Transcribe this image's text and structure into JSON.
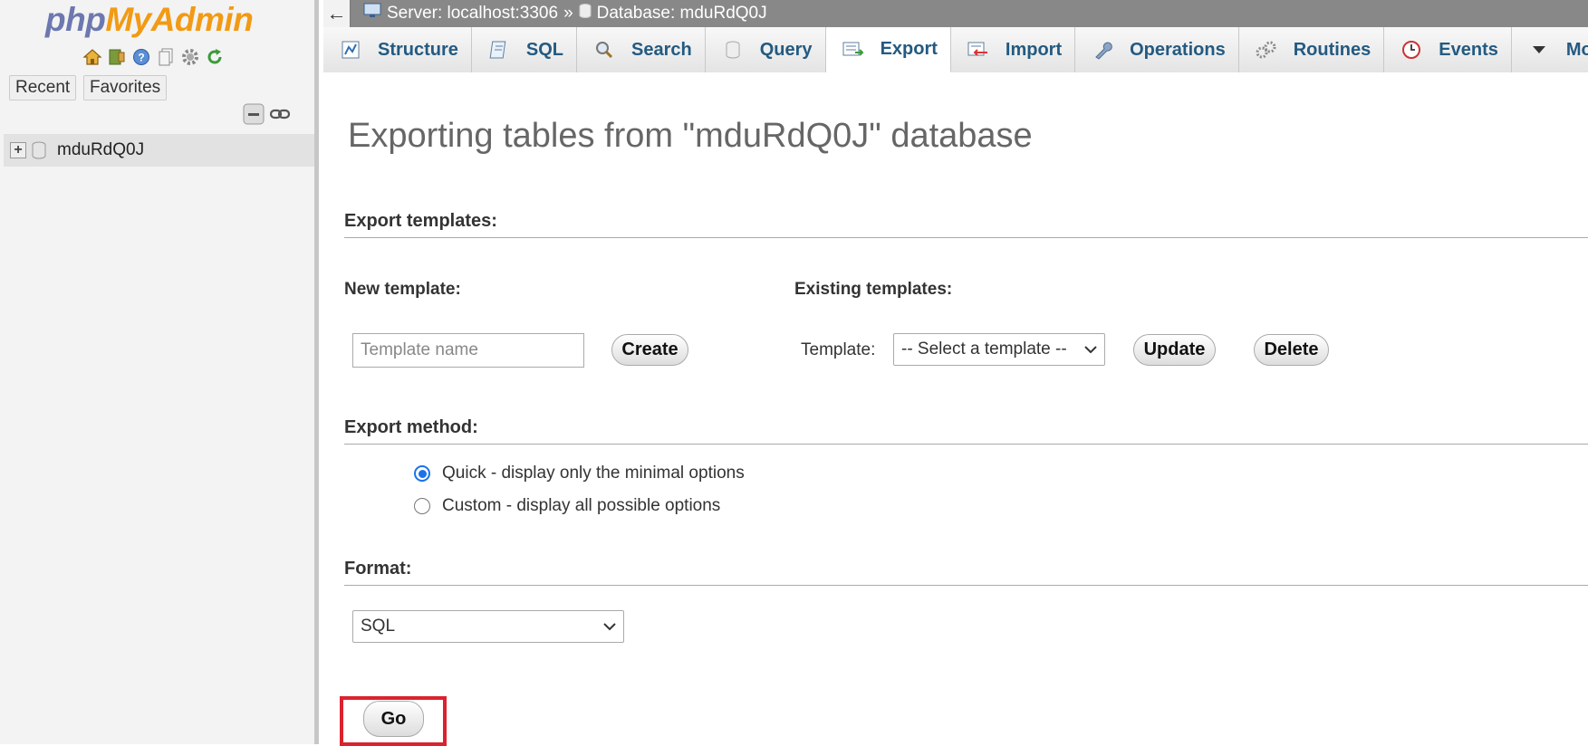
{
  "nav": {
    "logo_php": "php",
    "logo_myadmin": "MyAdmin",
    "icons": [
      "home-icon",
      "logout-icon",
      "help-icon",
      "docs-icon",
      "settings-icon",
      "reload-icon"
    ],
    "recent_label": "Recent",
    "favorites_label": "Favorites",
    "tree": [
      {
        "name": "mduRdQ0J"
      }
    ]
  },
  "topbar": {
    "back": "←",
    "server": "Server: localhost:3306",
    "separator": "»",
    "database": "Database: mduRdQ0J"
  },
  "tabs": [
    {
      "label": "Structure",
      "icon": "structure-icon"
    },
    {
      "label": "SQL",
      "icon": "sql-icon"
    },
    {
      "label": "Search",
      "icon": "search-icon"
    },
    {
      "label": "Query",
      "icon": "query-icon"
    },
    {
      "label": "Export",
      "icon": "export-icon",
      "active": true
    },
    {
      "label": "Import",
      "icon": "import-icon"
    },
    {
      "label": "Operations",
      "icon": "wrench-icon"
    },
    {
      "label": "Routines",
      "icon": "routines-icon"
    },
    {
      "label": "Events",
      "icon": "clock-icon"
    },
    {
      "label": "More",
      "icon": "caret-down-icon"
    }
  ],
  "main": {
    "title": "Exporting tables from \"mduRdQ0J\" database",
    "export_templates": {
      "heading": "Export templates:",
      "new_template_label": "New template:",
      "template_name_placeholder": "Template name",
      "create_label": "Create",
      "existing_templates_label": "Existing templates:",
      "template_label": "Template:",
      "select_value": "-- Select a template --",
      "update_label": "Update",
      "delete_label": "Delete"
    },
    "export_method": {
      "heading": "Export method:",
      "options": [
        {
          "label": "Quick - display only the minimal options",
          "checked": true
        },
        {
          "label": "Custom - display all possible options",
          "checked": false
        }
      ]
    },
    "format": {
      "heading": "Format:",
      "value": "SQL"
    },
    "go_label": "Go"
  },
  "colors": {
    "accent": "#235a81",
    "highlight": "#d9232e",
    "radio": "#1a73e8"
  }
}
